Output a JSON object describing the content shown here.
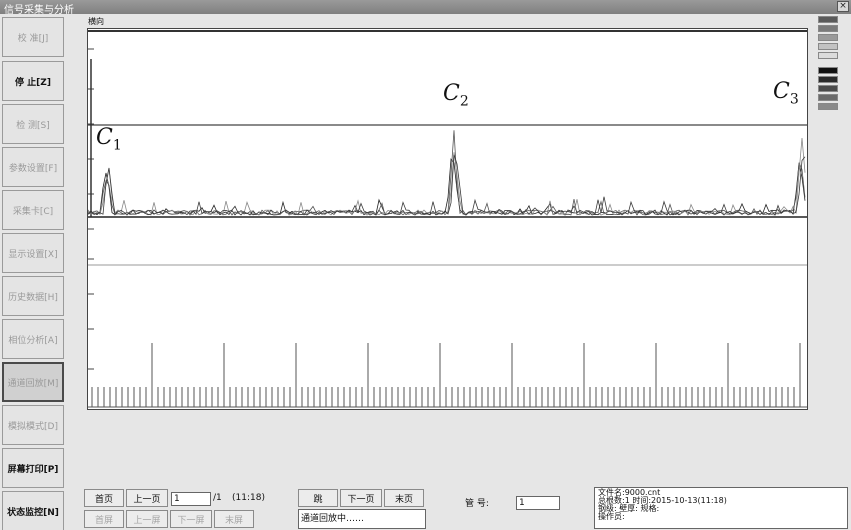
{
  "window": {
    "title": "信号采集与分析",
    "close_glyph": "×"
  },
  "sidebar": {
    "items": [
      {
        "label": "校  准[J]"
      },
      {
        "label": "停  止[Z]"
      },
      {
        "label": "检  测[S]"
      },
      {
        "label": "参数设置[F]"
      },
      {
        "label": "采集卡[C]"
      },
      {
        "label": "显示设置[X]"
      },
      {
        "label": "历史数据[H]"
      },
      {
        "label": "相位分析[A]"
      },
      {
        "label": "通道回放[M]"
      },
      {
        "label": "模拟模式[D]"
      },
      {
        "label": "屏幕打印[P]"
      },
      {
        "label": "状态监控[N]"
      }
    ]
  },
  "plot": {
    "label": "横向",
    "peaks": [
      {
        "letter": "C",
        "sub": "1"
      },
      {
        "letter": "C",
        "sub": "2"
      },
      {
        "letter": "C",
        "sub": "3"
      }
    ]
  },
  "swatch_colors": [
    "#5a5a5a",
    "#7a7a7a",
    "#9a9a9a",
    "#c2c2c2",
    "#dcdcdc",
    "#111111",
    "#2a2a2a",
    "#4a4a4a",
    "#6a6a6a",
    "#8a8a8a"
  ],
  "controls": {
    "first_page": "首页",
    "prev_page": "上一页",
    "page_value": "1",
    "page_total": "/1",
    "time_range": "(11:18)",
    "first_screen": "首屏",
    "prev_screen": "上一屏",
    "next_screen": "下一屏",
    "last_screen": "末屏",
    "jump": "跳",
    "next_page": "下一页",
    "last_page": "末页",
    "status_message": "通道回放中……",
    "tube_label": "管    号:",
    "tube_value": "1"
  },
  "file_info": {
    "line1": "文件名:9000.cnt",
    "line2": "总根数:1  时间:2015-10-13(11:18)",
    "line3": "钢级:  壁厚:  规格:",
    "line4": "操作员:"
  }
}
